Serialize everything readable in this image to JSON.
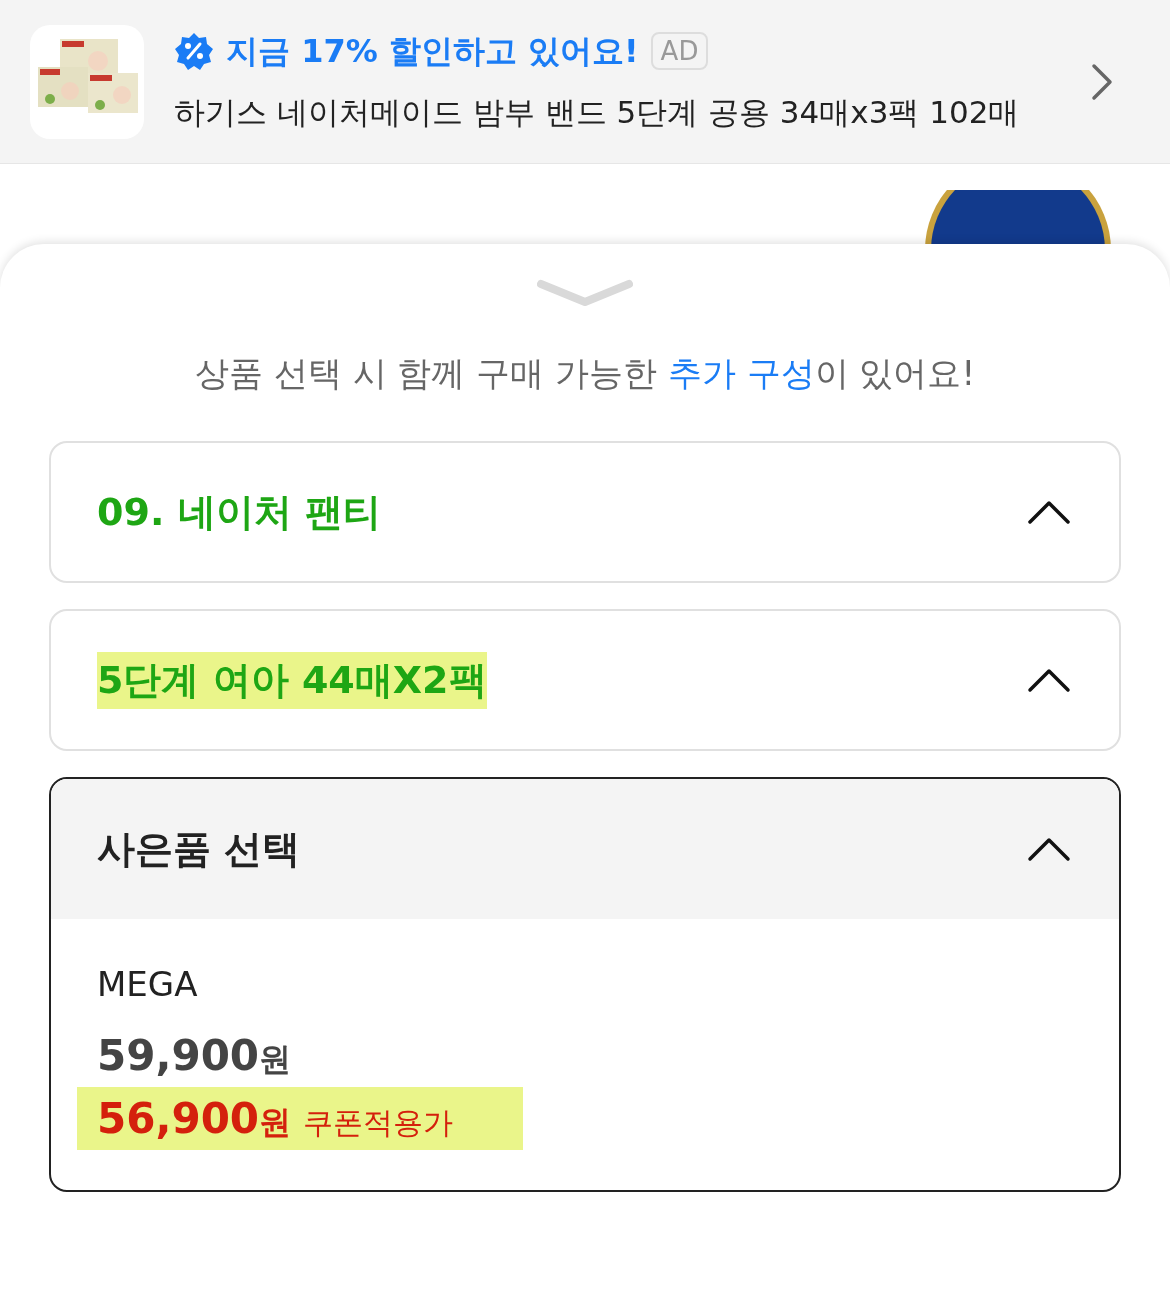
{
  "ad_banner": {
    "headline": "지금 17% 할인하고 있어요!",
    "ad_label": "AD",
    "product": "하기스 네이처메이드 밤부 밴드 5단계 공용 34매x3팩 102매"
  },
  "sheet": {
    "notice": "상품 선택 시 함께 구매 가능한 **추가 구성**이 있어요!",
    "selections": [
      {
        "label": "09. 네이처 팬티",
        "highlighted": false
      },
      {
        "label": "5단계 여아 44매X2팩",
        "highlighted": true
      }
    ],
    "gift": {
      "title": "사은품 선택",
      "option": {
        "name": "MEGA",
        "price": "59,900",
        "price_unit": "원",
        "coupon_price": "56,900",
        "coupon_unit": "원",
        "coupon_label": "쿠폰적용가",
        "highlighted": true
      }
    }
  }
}
